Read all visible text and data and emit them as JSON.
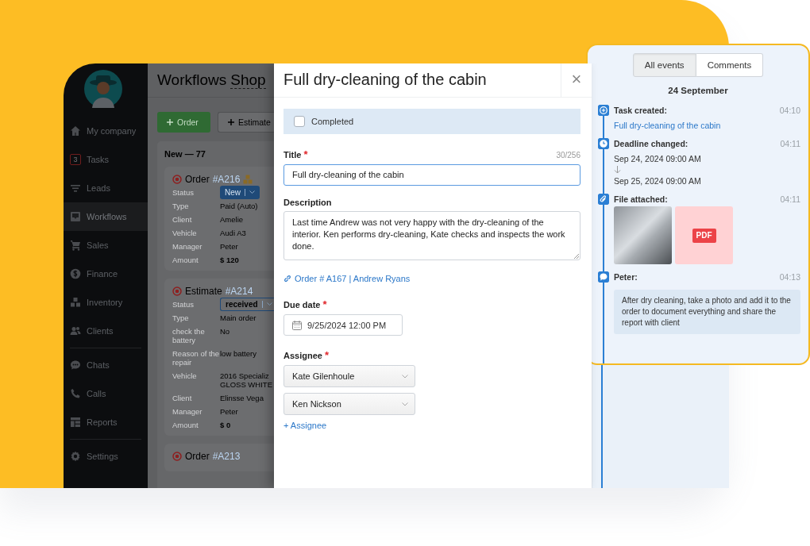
{
  "sidebar": {
    "groups": [
      {
        "items": [
          {
            "label": "My company",
            "selected": false
          },
          {
            "label": "Tasks",
            "badge": "3",
            "selected": false
          },
          {
            "label": "Leads",
            "selected": false
          },
          {
            "label": "Workflows",
            "selected": true
          },
          {
            "label": "Sales",
            "selected": false
          },
          {
            "label": "Finance",
            "selected": false
          },
          {
            "label": "Inventory",
            "selected": false
          },
          {
            "label": "Clients",
            "selected": false
          }
        ]
      },
      {
        "items": [
          {
            "label": "Chats",
            "selected": false
          },
          {
            "label": "Calls",
            "selected": false
          },
          {
            "label": "Reports",
            "selected": false
          }
        ]
      },
      {
        "items": [
          {
            "label": "Settings",
            "selected": false
          }
        ]
      }
    ]
  },
  "board": {
    "title": "Workflows",
    "subtitle": "Shop",
    "buttons": [
      {
        "label": "Order",
        "kind": "primary"
      },
      {
        "label": "Estimate",
        "kind": "secondary"
      }
    ],
    "column": {
      "title": "New — 77",
      "cards": [
        {
          "type": "Order",
          "number": "#A216",
          "packages": true,
          "fields": [
            {
              "label": "Status",
              "value": "New",
              "kind": "badge-filled"
            },
            {
              "label": "Type",
              "value": "Paid (Auto)",
              "kind": "text"
            },
            {
              "label": "Client",
              "value": "Amelie",
              "kind": "text"
            },
            {
              "label": "Vehicle",
              "value": "Audi A3",
              "kind": "text"
            },
            {
              "label": "Manager",
              "value": "Peter",
              "kind": "text"
            },
            {
              "label": "Amount",
              "value": "$ 120",
              "kind": "bold"
            }
          ]
        },
        {
          "type": "Estimate",
          "number": "#A214",
          "packages": false,
          "fields": [
            {
              "label": "Status",
              "value": "received",
              "kind": "badge-outlined"
            },
            {
              "label": "Type",
              "value": "Main order",
              "kind": "text"
            },
            {
              "label": "check the battery",
              "value": "No",
              "kind": "text"
            },
            {
              "label": "Reason of the repair",
              "value": "low battery",
              "kind": "text"
            },
            {
              "label": "Vehicle",
              "value": "2016 Specializ\nGLOSS WHITE",
              "kind": "text"
            },
            {
              "label": "Client",
              "value": "Elinsse Vega",
              "kind": "text"
            },
            {
              "label": "Manager",
              "value": "Peter",
              "kind": "text"
            },
            {
              "label": "Amount",
              "value": "$ 0",
              "kind": "bold"
            }
          ]
        },
        {
          "type": "Order",
          "number": "#A213",
          "packages": false
        }
      ]
    }
  },
  "task_panel": {
    "title": "Full dry-cleaning of the cabin",
    "close": "×",
    "completed": {
      "label": "Completed",
      "checked": false
    },
    "title_field": {
      "label": "Title",
      "mark": "*",
      "counter": "30/256",
      "value": "Full dry-cleaning of the cabin"
    },
    "description": {
      "label": "Description",
      "value": "Last time Andrew was not very happy with the dry-cleaning of the interior. Ken performs dry-cleaning, Kate checks and inspects the work done."
    },
    "link": "Order # A167 | Andrew Ryans",
    "due_date": {
      "label": "Due date",
      "mark": "*",
      "value": "9/25/2024 12:00 PM"
    },
    "assignee": {
      "label": "Assignee",
      "mark": "*",
      "values": [
        "Kate Gilenhoule",
        "Ken Nickson"
      ],
      "add": "+ Assignee"
    }
  },
  "activity": {
    "tabs": [
      {
        "label": "All events",
        "selected": true
      },
      {
        "label": "Comments",
        "selected": false
      }
    ],
    "date": "24 September",
    "events": [
      {
        "kind": "created",
        "title": "Task created:",
        "time": "04:10",
        "link": "Full dry-cleaning of the cabin"
      },
      {
        "kind": "deadline",
        "title": "Deadline changed:",
        "time": "04:11",
        "from": "Sep 24, 2024 09:00 AM",
        "to": "Sep 25, 2024 09:00 AM"
      },
      {
        "kind": "file",
        "title": "File attached:",
        "time": "04:11",
        "files": [
          {
            "kind": "photo"
          },
          {
            "kind": "pdf",
            "label": "PDF"
          }
        ]
      },
      {
        "kind": "comment",
        "title": "Peter:",
        "time": "04:13",
        "text": "After dry cleaning, take a photo and add it to the order to document everything and share the report with client"
      }
    ]
  }
}
